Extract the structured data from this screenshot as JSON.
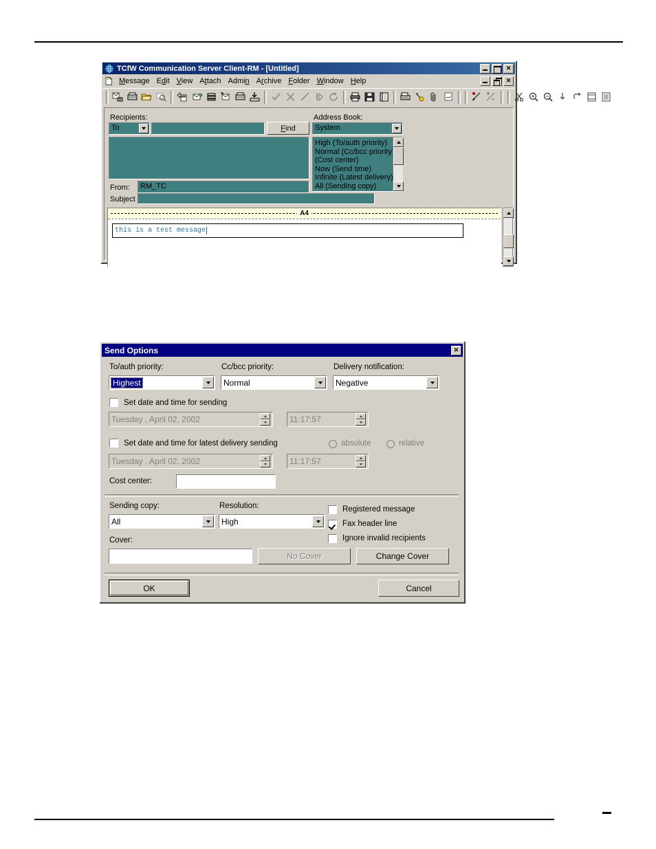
{
  "app_window": {
    "title": "TCfW Communication Server Client-RM - [Untitled]",
    "app_icon": "globe-icon",
    "window_controls": {
      "minimize": "_",
      "maximize": "□",
      "close": "✕"
    },
    "mdi_controls": {
      "minimize": "_",
      "restore": "❐",
      "close": "✕"
    },
    "mdi_icon": "document-icon",
    "menus": [
      {
        "pre": "",
        "key": "M",
        "post": "essage"
      },
      {
        "pre": "E",
        "key": "d",
        "post": "it"
      },
      {
        "pre": "",
        "key": "V",
        "post": "iew"
      },
      {
        "pre": "A",
        "key": "t",
        "post": "tach"
      },
      {
        "pre": "Admi",
        "key": "n",
        "post": ""
      },
      {
        "pre": "A",
        "key": "r",
        "post": "chive"
      },
      {
        "pre": "",
        "key": "F",
        "post": "older"
      },
      {
        "pre": "",
        "key": "W",
        "post": "indow"
      },
      {
        "pre": "",
        "key": "H",
        "post": "elp"
      }
    ],
    "toolbar_groups": [
      [
        "new-message-icon",
        "new-fax-icon",
        "open-folder-icon",
        "search-message-icon"
      ],
      [
        "reply-icon",
        "reply-all-icon",
        "forward-icon",
        "move-message-icon",
        "archive-icon",
        "export-icon"
      ],
      [
        "accept-check-icon",
        "reject-x-icon",
        "edit-pencil-icon",
        "pause-icon",
        "resend-refresh-icon"
      ],
      [
        "print-icon",
        "save-icon",
        "address-book-icon"
      ],
      [
        "fax-machine-icon",
        "attach-key-icon",
        "paperclip-icon",
        "signature-icon"
      ],
      [
        "priority-high-icon",
        "priority-normal-icon"
      ],
      [
        "cut-icon",
        "zoom-in-icon",
        "zoom-out-icon",
        "page-down-icon",
        "rotate-icon",
        "fit-page-icon",
        "list-view-icon"
      ]
    ],
    "form": {
      "recipients_label": "Recipients:",
      "recipient_type": "To",
      "recipient_value": "",
      "find_button": {
        "pre": "",
        "key": "F",
        "post": "ind"
      },
      "recipients_list": [],
      "from_label": "From:",
      "from_value": "RM_TC",
      "subject_label": "Subject",
      "subject_value": "",
      "address_book_label": "Address Book:",
      "address_book_selected": "System",
      "address_book_items": [
        "High   (To/auth priority)",
        "Normal   (Cc/bcc priority)",
        "   (Cost center)",
        "Now   (Send time)",
        "Infinite   (Latest delivery)",
        "All   (Sending copy)"
      ],
      "page_marker": "A4",
      "body_text": "this is a test message"
    }
  },
  "send_options": {
    "title": "Send Options",
    "close_label": "✕",
    "to_auth_priority": {
      "label": "To/auth priority:",
      "value": "Highest"
    },
    "cc_bcc_priority": {
      "label": "Cc/bcc priority:",
      "value": "Normal"
    },
    "delivery_notification": {
      "label": "Delivery notification:",
      "value": "Negative"
    },
    "set_send_datetime": {
      "label": "Set date and time for sending",
      "checked": false
    },
    "send_date": "Tuesday   ,     April     02, 2002",
    "send_time": "11:17:57",
    "set_latest_delivery": {
      "label": "Set date and time for latest delivery sending",
      "checked": false
    },
    "absolute_radio": {
      "label": "absolute",
      "selected": false
    },
    "relative_radio": {
      "label": "relative",
      "selected": false
    },
    "latest_date": "Tuesday   ,     April     02, 2002",
    "latest_time": "11:17:57",
    "cost_center": {
      "label": "Cost center:",
      "value": ""
    },
    "sending_copy": {
      "label": "Sending copy:",
      "value": "All"
    },
    "resolution": {
      "label": "Resolution:",
      "value": "High"
    },
    "registered_message": {
      "label": "Registered message",
      "checked": false
    },
    "fax_header_line": {
      "label": "Fax header line",
      "checked": true
    },
    "ignore_invalid_recipients": {
      "label": "Ignore invalid recipients",
      "checked": false
    },
    "cover": {
      "label": "Cover:",
      "value": ""
    },
    "no_cover_button": "No Cover",
    "change_cover_button": "Change Cover",
    "ok_button": "OK",
    "cancel_button": "Cancel"
  },
  "colors": {
    "teal_field": "#3f7f7f",
    "dialog_face": "#d4d0c8",
    "dialog_titlebar": "#000080",
    "app_titlebar": "#0a246a",
    "selection": "#000080",
    "body_text": "#2a6ea5",
    "page_marker_bg": "#ffffe0"
  }
}
